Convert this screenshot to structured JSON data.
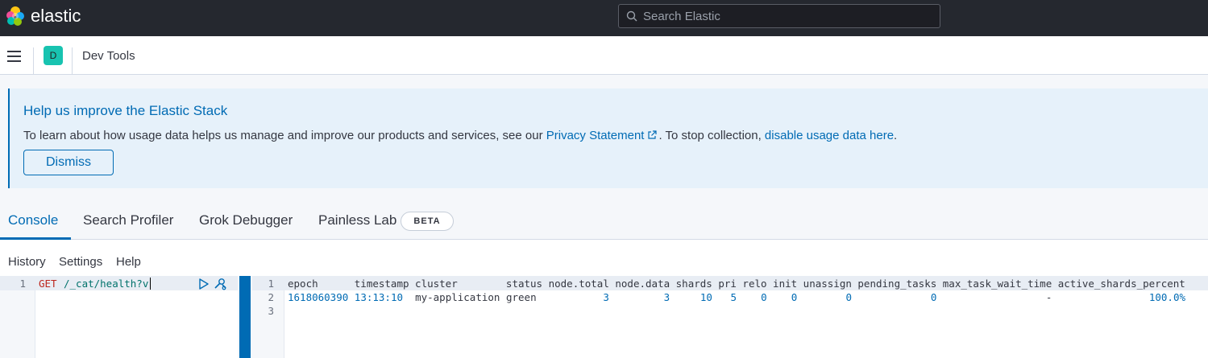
{
  "header": {
    "brand": "elastic",
    "search_placeholder": "Search Elastic"
  },
  "subheader": {
    "space_initial": "D",
    "breadcrumb": "Dev Tools"
  },
  "callout": {
    "title": "Help us improve the Elastic Stack",
    "text_before": "To learn about how usage data helps us manage and improve our products and services, see our ",
    "privacy_link": "Privacy Statement",
    "text_middle": ". To stop collection, ",
    "disable_link": "disable usage data here",
    "text_after": ".",
    "dismiss_label": "Dismiss"
  },
  "tabs": [
    {
      "label": "Console",
      "active": true
    },
    {
      "label": "Search Profiler"
    },
    {
      "label": "Grok Debugger"
    },
    {
      "label": "Painless Lab"
    }
  ],
  "beta_badge": "BETA",
  "console_menu": {
    "history": "History",
    "settings": "Settings",
    "help": "Help"
  },
  "request": {
    "line_numbers": [
      "1"
    ],
    "method": "GET",
    "path": "/_cat/health?v"
  },
  "response": {
    "line_numbers": [
      "1",
      "2",
      "3"
    ],
    "header_line": "epoch      timestamp cluster        status node.total node.data shards pri relo init unassign pending_tasks max_task_wait_time active_shards_percent",
    "row": {
      "epoch": "1618060390",
      "timestamp": "13:13:10",
      "cluster": "my-application",
      "status": "green",
      "node_total": "3",
      "node_data": "3",
      "shards": "10",
      "pri": "5",
      "relo": "0",
      "init": "0",
      "unassign": "0",
      "pending_tasks": "0",
      "max_task_wait_time": "-",
      "active_shards_percent": "100.0%"
    }
  },
  "colors": {
    "accent": "#006bb4",
    "header_bg": "#25282f",
    "callout_bg": "#e6f1fa",
    "space_avatar": "#18c3b0",
    "method": "#bd271e",
    "path": "#00726b"
  }
}
